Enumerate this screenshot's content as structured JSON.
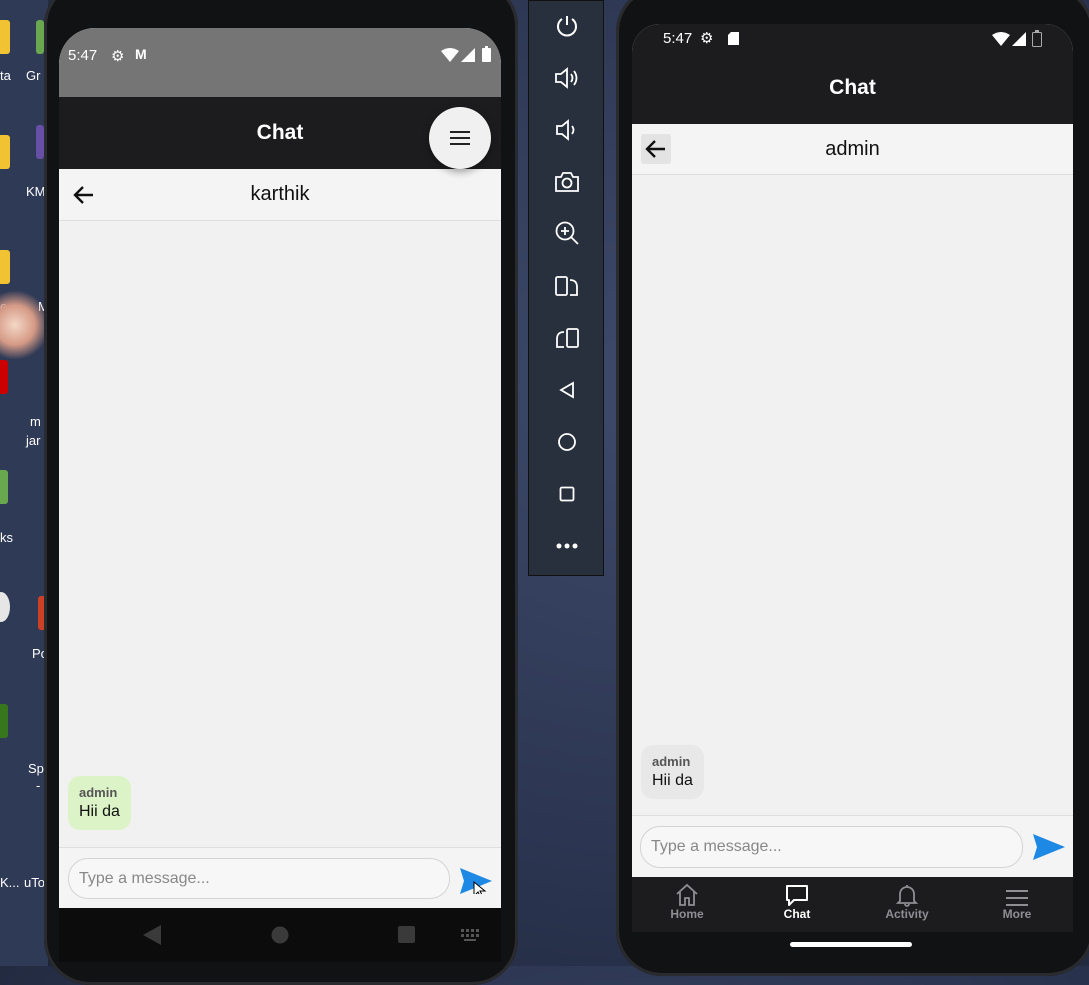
{
  "desktop": {
    "labels": [
      "ta",
      "Gr",
      "KM",
      "e",
      "M",
      "m",
      "jar",
      "ks",
      "Po",
      "Sp",
      "-",
      "K...",
      "uTo"
    ]
  },
  "left_phone": {
    "status": {
      "time": "5:47"
    },
    "app_title": "Chat",
    "conversation_title": "karthik",
    "messages": [
      {
        "sender": "admin",
        "text": "Hii da"
      }
    ],
    "input_placeholder": "Type a message..."
  },
  "emulator_toolbar": {
    "buttons": [
      "power",
      "volume-up",
      "volume-down",
      "screenshot",
      "zoom",
      "rotate-left",
      "rotate-right",
      "back",
      "home",
      "overview",
      "more"
    ]
  },
  "right_phone": {
    "status": {
      "time": "5:47"
    },
    "app_title": "Chat",
    "conversation_title": "admin",
    "messages": [
      {
        "sender": "admin",
        "text": "Hii da"
      }
    ],
    "input_placeholder": "Type a message...",
    "bottom_nav": [
      {
        "label": "Home",
        "icon": "home-icon",
        "active": false
      },
      {
        "label": "Chat",
        "icon": "chat-icon",
        "active": true
      },
      {
        "label": "Activity",
        "icon": "bell-icon",
        "active": false
      },
      {
        "label": "More",
        "icon": "menu-icon",
        "active": false
      }
    ]
  },
  "colors": {
    "accent": "#1e88e5",
    "appbar": "#1c1c1e",
    "bubble_left": "#dcf3c8",
    "bubble_right": "#e8e8e8"
  }
}
